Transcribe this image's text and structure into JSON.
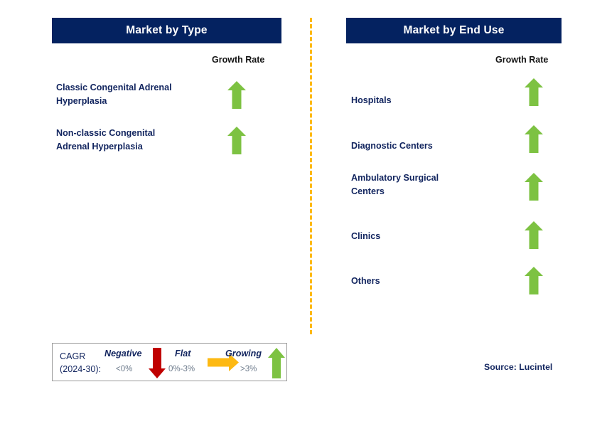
{
  "colors": {
    "header_bg": "#042260",
    "header_text": "#ffffff",
    "label_navy": "#12255f",
    "arrow_green": "#7DC242",
    "arrow_red": "#C00000",
    "arrow_yellow": "#FDB913",
    "divider": "#FDB913",
    "legend_border": "#9a9a9a",
    "range_gray": "#6d7b8c"
  },
  "panels": [
    {
      "id": "market-by-type",
      "title": "Market by Type",
      "growth_rate_label": "Growth Rate",
      "items": [
        {
          "label": "Classic Congenital Adrenal\nHyperplasia",
          "growth": "Growing",
          "icon": "arrow-up-icon"
        },
        {
          "label": "Non-classic Congenital\nAdrenal Hyperplasia",
          "growth": "Growing",
          "icon": "arrow-up-icon"
        }
      ]
    },
    {
      "id": "market-by-end-use",
      "title": "Market by End Use",
      "growth_rate_label": "Growth Rate",
      "items": [
        {
          "label": "Hospitals",
          "growth": "Growing",
          "icon": "arrow-up-icon"
        },
        {
          "label": "Diagnostic Centers",
          "growth": "Growing",
          "icon": "arrow-up-icon"
        },
        {
          "label": "Ambulatory Surgical\nCenters",
          "growth": "Growing",
          "icon": "arrow-up-icon"
        },
        {
          "label": "Clinics",
          "growth": "Growing",
          "icon": "arrow-up-icon"
        },
        {
          "label": "Others",
          "growth": "Growing",
          "icon": "arrow-up-icon"
        }
      ]
    }
  ],
  "legend": {
    "title": "CAGR\n(2024-30):",
    "entries": [
      {
        "term": "Negative",
        "range": "<0%",
        "icon": "arrow-down-icon"
      },
      {
        "term": "Flat",
        "range": "0%-3%",
        "icon": "arrow-right-icon"
      },
      {
        "term": "Growing",
        "range": ">3%",
        "icon": "arrow-up-icon"
      }
    ]
  },
  "source": "Source: Lucintel"
}
